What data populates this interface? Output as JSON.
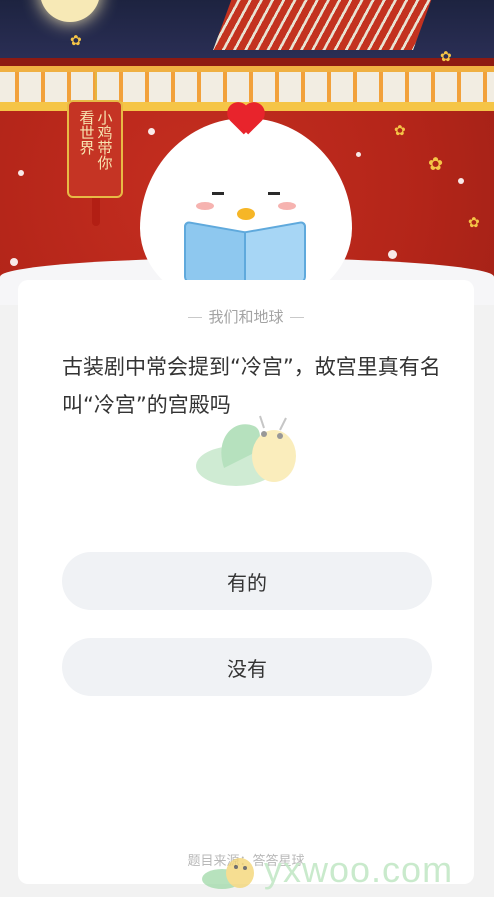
{
  "banner": {
    "tag_lines": [
      "小鸡带你",
      "看世界"
    ],
    "tag_col_right": "小鸡带你",
    "tag_col_left": "看世界"
  },
  "card": {
    "source_title": "我们和地球",
    "question": "古装剧中常会提到“冷宫”，故宫里真有名叫“冷宫”的宫殿吗",
    "options": [
      {
        "label": "有的"
      },
      {
        "label": "没有"
      }
    ],
    "footer": "题目来源：答答星球"
  },
  "watermark": {
    "text": "yxwoo.com"
  },
  "colors": {
    "banner_red": "#b42419",
    "comb_red": "#e8242c",
    "option_bg": "#f0f2f5",
    "muted_text": "#a3a3a3",
    "watermark_green": "#c4e8c7"
  }
}
